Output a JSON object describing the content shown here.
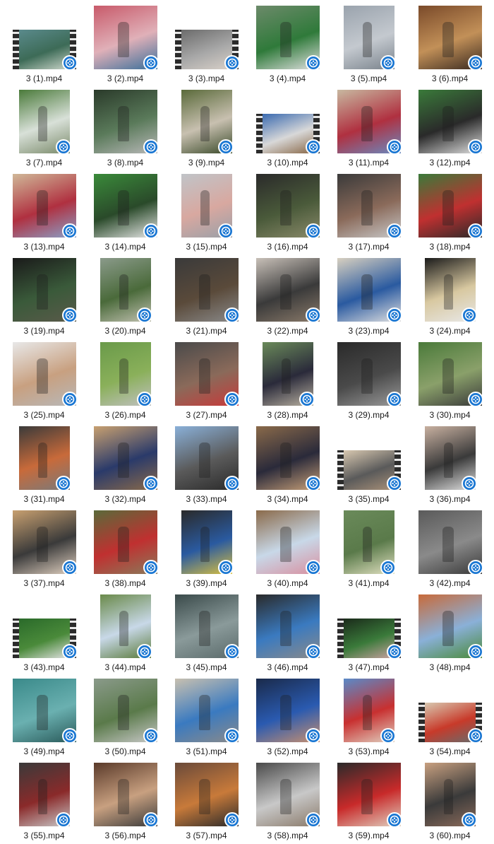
{
  "files": [
    {
      "name": "3 (1).mp4",
      "thumb": "film",
      "colors": [
        "#5a8a8c",
        "#3d6b57",
        "#c9d4c8"
      ]
    },
    {
      "name": "3 (2).mp4",
      "thumb": "square",
      "colors": [
        "#c85a6a",
        "#e0b0b8",
        "#3a6f9a"
      ]
    },
    {
      "name": "3 (3).mp4",
      "thumb": "film",
      "colors": [
        "#6b6b6b",
        "#a8a8a8",
        "#d8d0c8"
      ]
    },
    {
      "name": "3 (4).mp4",
      "thumb": "square",
      "colors": [
        "#6c8a6a",
        "#2f7a3a",
        "#e0e0e0"
      ]
    },
    {
      "name": "3 (5).mp4",
      "thumb": "tall",
      "colors": [
        "#9aa3ad",
        "#c4c9cf",
        "#7a838c"
      ]
    },
    {
      "name": "3 (6).mp4",
      "thumb": "square",
      "colors": [
        "#7a4a2a",
        "#c29058",
        "#3a2a20"
      ]
    },
    {
      "name": "3 (7).mp4",
      "thumb": "tall",
      "colors": [
        "#4a7a3a",
        "#d8e0d8",
        "#7a8a6a"
      ]
    },
    {
      "name": "3 (8).mp4",
      "thumb": "square",
      "colors": [
        "#2a3a2a",
        "#5a7a5a",
        "#b8b8b8"
      ]
    },
    {
      "name": "3 (9).mp4",
      "thumb": "tall",
      "colors": [
        "#5a6a3a",
        "#c8c0b0",
        "#3a4a2a"
      ]
    },
    {
      "name": "3 (10).mp4",
      "thumb": "film",
      "colors": [
        "#3a6ab0",
        "#d8d8d8",
        "#8a6a4a"
      ]
    },
    {
      "name": "3 (11).mp4",
      "thumb": "square",
      "colors": [
        "#c8b8a0",
        "#b03040",
        "#6a8ac0"
      ]
    },
    {
      "name": "3 (12).mp4",
      "thumb": "square",
      "colors": [
        "#3a7a3a",
        "#2a2a2a",
        "#e0e0e0"
      ]
    },
    {
      "name": "3 (13).mp4",
      "thumb": "square",
      "colors": [
        "#d0b898",
        "#b03040",
        "#8aa0c8"
      ]
    },
    {
      "name": "3 (14).mp4",
      "thumb": "square",
      "colors": [
        "#3a8a3a",
        "#2a4a2a",
        "#e8e8e8"
      ]
    },
    {
      "name": "3 (15).mp4",
      "thumb": "tall",
      "colors": [
        "#c0c4c8",
        "#d8a8a0",
        "#9aa0a8"
      ]
    },
    {
      "name": "3 (16).mp4",
      "thumb": "square",
      "colors": [
        "#2a2a2a",
        "#4a5a3a",
        "#8a8a6a"
      ]
    },
    {
      "name": "3 (17).mp4",
      "thumb": "square",
      "colors": [
        "#3a3a3a",
        "#8a6a5a",
        "#c8c8c8"
      ]
    },
    {
      "name": "3 (18).mp4",
      "thumb": "square",
      "colors": [
        "#3a7a3a",
        "#c03030",
        "#2a2a2a"
      ]
    },
    {
      "name": "3 (19).mp4",
      "thumb": "square",
      "colors": [
        "#1a1a1a",
        "#3a5a3a",
        "#5a5a4a"
      ]
    },
    {
      "name": "3 (20).mp4",
      "thumb": "tall",
      "colors": [
        "#8a9a8a",
        "#4a6a3a",
        "#c0c0b0"
      ]
    },
    {
      "name": "3 (21).mp4",
      "thumb": "square",
      "colors": [
        "#3a3a3a",
        "#5a4a3a",
        "#8a8a8a"
      ]
    },
    {
      "name": "3 (22).mp4",
      "thumb": "square",
      "colors": [
        "#c8c0b8",
        "#3a3a3a",
        "#8a7a6a"
      ]
    },
    {
      "name": "3 (23).mp4",
      "thumb": "square",
      "colors": [
        "#d8d0c0",
        "#2a5aa0",
        "#e0e0e0"
      ]
    },
    {
      "name": "3 (24).mp4",
      "thumb": "tall",
      "colors": [
        "#1a1a1a",
        "#d8c8a0",
        "#e8e8e8"
      ]
    },
    {
      "name": "3 (25).mp4",
      "thumb": "square",
      "colors": [
        "#e8e8e8",
        "#c8a080",
        "#b8b8b8"
      ]
    },
    {
      "name": "3 (26).mp4",
      "thumb": "tall",
      "colors": [
        "#6a9a4a",
        "#8ab05a",
        "#c0c0c0"
      ]
    },
    {
      "name": "3 (27).mp4",
      "thumb": "square",
      "colors": [
        "#4a4a4a",
        "#8a6a5a",
        "#c83a3a"
      ]
    },
    {
      "name": "3 (28).mp4",
      "thumb": "tall",
      "colors": [
        "#6a8a5a",
        "#2a2a3a",
        "#b8b0a0"
      ]
    },
    {
      "name": "3 (29).mp4",
      "thumb": "square",
      "colors": [
        "#2a2a2a",
        "#4a4a4a",
        "#9a9a9a"
      ]
    },
    {
      "name": "3 (30).mp4",
      "thumb": "square",
      "colors": [
        "#4a7a3a",
        "#8aa06a",
        "#3a3a3a"
      ]
    },
    {
      "name": "3 (31).mp4",
      "thumb": "tall",
      "colors": [
        "#3a3a3a",
        "#c86a3a",
        "#7a7a7a"
      ]
    },
    {
      "name": "3 (32).mp4",
      "thumb": "square",
      "colors": [
        "#c8a070",
        "#2a3a6a",
        "#8a6a4a"
      ]
    },
    {
      "name": "3 (33).mp4",
      "thumb": "square",
      "colors": [
        "#8ab0d8",
        "#5a5a5a",
        "#2a2a2a"
      ]
    },
    {
      "name": "3 (34).mp4",
      "thumb": "square",
      "colors": [
        "#8a6a4a",
        "#2a2a3a",
        "#c8a078"
      ]
    },
    {
      "name": "3 (35).mp4",
      "thumb": "film",
      "colors": [
        "#d8c8b0",
        "#5a5a5a",
        "#a89078"
      ]
    },
    {
      "name": "3 (36).mp4",
      "thumb": "tall",
      "colors": [
        "#c8b0a0",
        "#3a3a3a",
        "#e0e0e0"
      ]
    },
    {
      "name": "3 (37).mp4",
      "thumb": "square",
      "colors": [
        "#c8a070",
        "#3a3a3a",
        "#e0d0c0"
      ]
    },
    {
      "name": "3 (38).mp4",
      "thumb": "square",
      "colors": [
        "#5a6a3a",
        "#c03030",
        "#8a7a5a"
      ]
    },
    {
      "name": "3 (39).mp4",
      "thumb": "tall",
      "colors": [
        "#2a2a2a",
        "#2a5aa0",
        "#d8c040"
      ]
    },
    {
      "name": "3 (40).mp4",
      "thumb": "square",
      "colors": [
        "#8a6a4a",
        "#c8d8e8",
        "#d890a0"
      ]
    },
    {
      "name": "3 (41).mp4",
      "thumb": "tall",
      "colors": [
        "#6a8a5a",
        "#5a7a4a",
        "#e0e0c0"
      ]
    },
    {
      "name": "3 (42).mp4",
      "thumb": "square",
      "colors": [
        "#5a5a5a",
        "#8a8a8a",
        "#3a3a3a"
      ]
    },
    {
      "name": "3 (43).mp4",
      "thumb": "film",
      "colors": [
        "#2a6a2a",
        "#4a8a3a",
        "#e0e0e0"
      ]
    },
    {
      "name": "3 (44).mp4",
      "thumb": "tall",
      "colors": [
        "#6a8a4a",
        "#c8d8e8",
        "#5a7a3a"
      ]
    },
    {
      "name": "3 (45).mp4",
      "thumb": "square",
      "colors": [
        "#3a4a4a",
        "#8a9a9a",
        "#5a6a6a"
      ]
    },
    {
      "name": "3 (46).mp4",
      "thumb": "square",
      "colors": [
        "#2a2a2a",
        "#3a7ac0",
        "#8a8a8a"
      ]
    },
    {
      "name": "3 (47).mp4",
      "thumb": "film",
      "colors": [
        "#1a2a1a",
        "#3a7a3a",
        "#c8a0a0"
      ]
    },
    {
      "name": "3 (48).mp4",
      "thumb": "square",
      "colors": [
        "#c86a3a",
        "#8ab0d8",
        "#4a8a3a"
      ]
    },
    {
      "name": "3 (49).mp4",
      "thumb": "square",
      "colors": [
        "#3a8a8a",
        "#6ab0b0",
        "#2a5a5a"
      ]
    },
    {
      "name": "3 (50).mp4",
      "thumb": "square",
      "colors": [
        "#8a9a8a",
        "#5a7a4a",
        "#c8c8c8"
      ]
    },
    {
      "name": "3 (51).mp4",
      "thumb": "square",
      "colors": [
        "#c8c0b0",
        "#3a7ac0",
        "#8a8a8a"
      ]
    },
    {
      "name": "3 (52).mp4",
      "thumb": "square",
      "colors": [
        "#1a2a4a",
        "#2a5ab0",
        "#c89070"
      ]
    },
    {
      "name": "3 (53).mp4",
      "thumb": "tall",
      "colors": [
        "#5a8ac8",
        "#c83030",
        "#e0d0c0"
      ]
    },
    {
      "name": "3 (54).mp4",
      "thumb": "film",
      "colors": [
        "#d8c8b0",
        "#c83a2a",
        "#6a6a6a"
      ]
    },
    {
      "name": "3 (55).mp4",
      "thumb": "tall",
      "colors": [
        "#3a3a3a",
        "#8a2a2a",
        "#c8c8c8"
      ]
    },
    {
      "name": "3 (56).mp4",
      "thumb": "square",
      "colors": [
        "#5a3a2a",
        "#c8a080",
        "#3a3a3a"
      ]
    },
    {
      "name": "3 (57).mp4",
      "thumb": "square",
      "colors": [
        "#6a4a3a",
        "#c87a3a",
        "#2a2a2a"
      ]
    },
    {
      "name": "3 (58).mp4",
      "thumb": "square",
      "colors": [
        "#4a4a4a",
        "#c8c8c8",
        "#8a7a6a"
      ]
    },
    {
      "name": "3 (59).mp4",
      "thumb": "square",
      "colors": [
        "#2a2a2a",
        "#c82a2a",
        "#e0d0c0"
      ]
    },
    {
      "name": "3 (60).mp4",
      "thumb": "tall",
      "colors": [
        "#c8a080",
        "#3a3a3a",
        "#8a6a5a"
      ]
    }
  ],
  "badge": {
    "icon": "video-file-icon",
    "color": "#1976d2"
  }
}
